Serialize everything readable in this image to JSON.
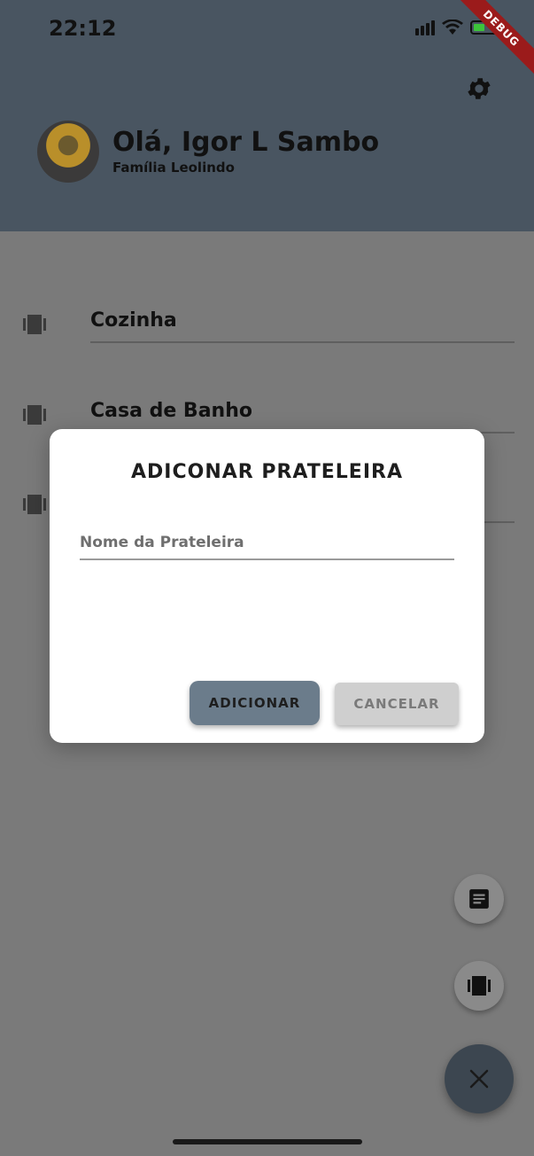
{
  "status_bar": {
    "time": "22:12",
    "debug_label": "DEBUG"
  },
  "header": {
    "greeting": "Olá, Igor L Sambo",
    "family": "Família Leolindo",
    "settings_icon": "gear-icon"
  },
  "shelves": [
    {
      "label": "Cozinha",
      "icon": "shelf-icon"
    },
    {
      "label": "Casa de Banho",
      "icon": "shelf-icon"
    },
    {
      "label": "",
      "icon": "shelf-icon"
    }
  ],
  "dialog": {
    "title": "ADICONAR PRATELEIRA",
    "input_placeholder": "Nome da Prateleira",
    "input_value": "",
    "add_label": "ADICIONAR",
    "cancel_label": "CANCELAR"
  },
  "fabs": {
    "notes_icon": "notes-icon",
    "shelf_icon": "shelf-icon",
    "close_icon": "close-icon"
  },
  "colors": {
    "header_bg": "#495561",
    "scrim_bg": "#7a7a7a",
    "add_button": "#6b7c8b",
    "cancel_button": "#cfcfcf",
    "fab_main": "#3c4650",
    "debug_ribbon": "#9b1b1b"
  }
}
